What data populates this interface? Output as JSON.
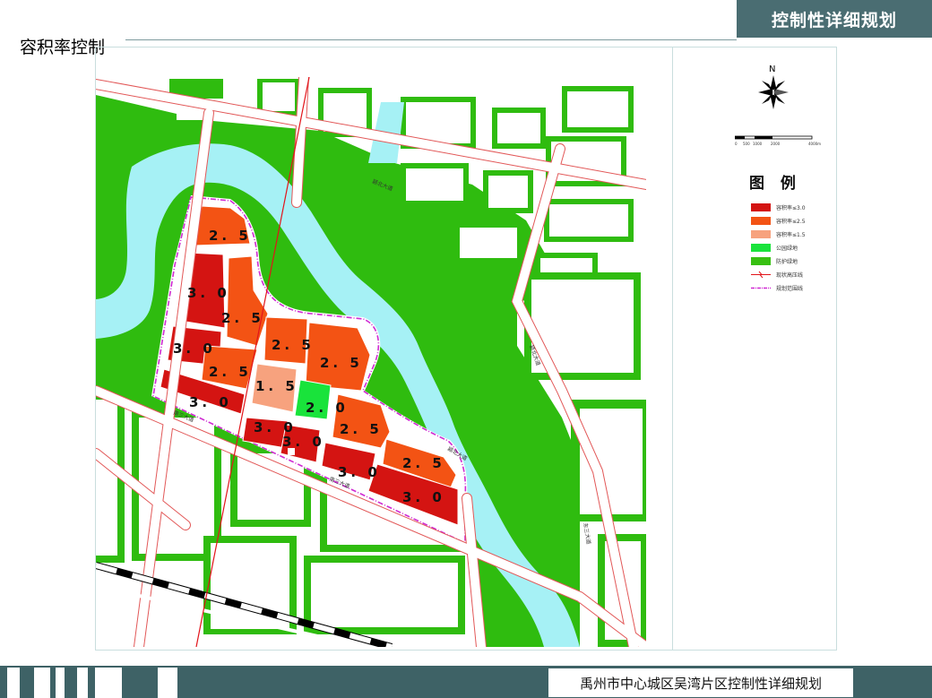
{
  "header": {
    "title": "控制性详细规划"
  },
  "section_title": "容积率控制",
  "footer": {
    "title": "禹州市中心城区吴湾片区控制性详细规划"
  },
  "compass": {
    "north_label": "N"
  },
  "scale_bar": {
    "labels": [
      "0",
      "500",
      "1000",
      "2000",
      "4000m"
    ]
  },
  "legend": {
    "title": "图 例",
    "items": [
      {
        "label": "容积率≤3.0",
        "color": "#d41412",
        "kind": "swatch"
      },
      {
        "label": "容积率≤2.5",
        "color": "#f35314",
        "kind": "swatch"
      },
      {
        "label": "容积率≤1.5",
        "color": "#f7a27e",
        "kind": "swatch"
      },
      {
        "label": "公园绿地",
        "color": "#19e33b",
        "kind": "swatch"
      },
      {
        "label": "防护绿地",
        "color": "#38c012",
        "kind": "swatch"
      },
      {
        "label": "现状高压线",
        "color": "#e2141a",
        "kind": "powerline"
      },
      {
        "label": "规划范围线",
        "color": "#cf2ad2",
        "kind": "boundary"
      }
    ]
  },
  "map": {
    "colors": {
      "green": "#2fbc0f",
      "water": "#a6f1f5",
      "road": "#ffffff",
      "road_edge": "#e25858",
      "boundary": "#cf2ad2",
      "powerline": "#e2141a",
      "rail": "#000000"
    },
    "parcels": [
      {
        "label": "2. 5",
        "fill": "#f35314"
      },
      {
        "label": "3. 0",
        "fill": "#d41412"
      },
      {
        "label": "2. 5",
        "fill": "#f35314"
      },
      {
        "label": "3. 0",
        "fill": "#d41412"
      },
      {
        "label": "2. 5",
        "fill": "#f35314"
      },
      {
        "label": "2. 5",
        "fill": "#f35314"
      },
      {
        "label": "2. 5",
        "fill": "#f35314"
      },
      {
        "label": "3. 0",
        "fill": "#d41412"
      },
      {
        "label": "1. 5",
        "fill": "#f7a27e"
      },
      {
        "label": "2. 0",
        "fill": "#19e33b"
      },
      {
        "label": "3. 0",
        "fill": "#d41412"
      },
      {
        "label": "3. 0",
        "fill": "#d41412"
      },
      {
        "label": "2. 5",
        "fill": "#f35314"
      },
      {
        "label": "2. 5",
        "fill": "#f35314"
      },
      {
        "label": "3. 0",
        "fill": "#d41412"
      },
      {
        "label": "3. 0",
        "fill": "#d41412"
      }
    ],
    "road_labels": [
      "颍北大道",
      "颍北大道",
      "南三大道",
      "南三大道",
      "颍北大道",
      "东三大道"
    ]
  }
}
